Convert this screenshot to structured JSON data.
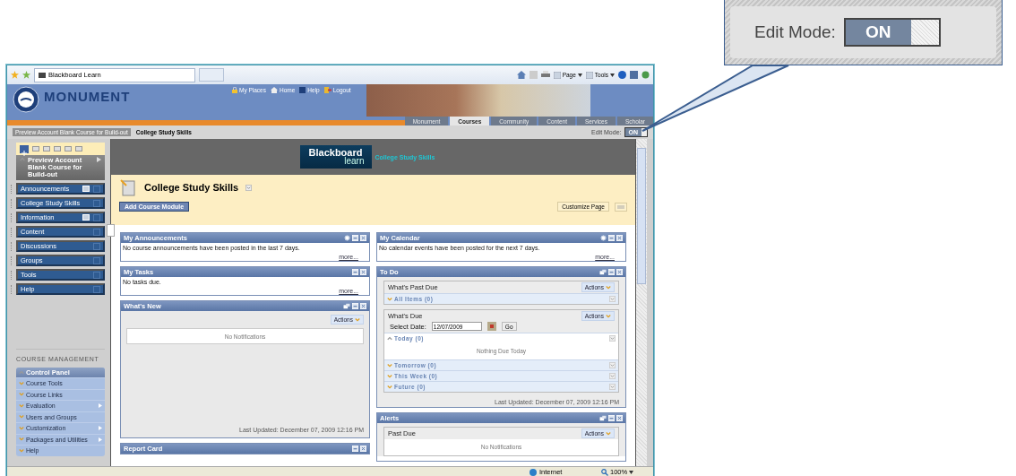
{
  "browser": {
    "tab_title": "Blackboard Learn",
    "menus": [
      "Page",
      "Tools"
    ]
  },
  "header": {
    "brand": "MONUMENT",
    "links": [
      "My Places",
      "Home",
      "Help",
      "Logout"
    ],
    "tabs": [
      {
        "label": "Monument",
        "selected": false
      },
      {
        "label": "Courses",
        "selected": true
      },
      {
        "label": "Community",
        "selected": false
      },
      {
        "label": "Content",
        "selected": false
      },
      {
        "label": "Services",
        "selected": false
      },
      {
        "label": "Scholar",
        "selected": false
      }
    ]
  },
  "breadcrumb": {
    "items": [
      "Preview Account Blank Course for Build-out",
      "College Study Skills"
    ],
    "edit_mode": {
      "label": "Edit Mode:",
      "value": "ON",
      "on": true
    }
  },
  "sidebar": {
    "course_title": "Preview Account Blank Course for Build-out",
    "items": [
      {
        "label": "Announcements",
        "badge": true
      },
      {
        "label": "College Study Skills",
        "badge": false
      },
      {
        "label": "Information",
        "badge": true
      },
      {
        "label": "Content",
        "badge": false
      },
      {
        "label": "Discussions",
        "badge": false
      },
      {
        "label": "Groups",
        "badge": false
      },
      {
        "label": "Tools",
        "badge": false
      },
      {
        "label": "Help",
        "badge": false
      }
    ],
    "management_title": "COURSE MANAGEMENT",
    "control_panel": {
      "title": "Control Panel",
      "expanded": true,
      "items": [
        {
          "label": "Course Tools",
          "submenu": false
        },
        {
          "label": "Course Links",
          "submenu": false
        },
        {
          "label": "Evaluation",
          "submenu": true
        },
        {
          "label": "Users and Groups",
          "submenu": false
        },
        {
          "label": "Customization",
          "submenu": true
        },
        {
          "label": "Packages and Utilities",
          "submenu": true
        },
        {
          "label": "Help",
          "submenu": false
        }
      ]
    }
  },
  "banner": {
    "logo_top": "Blackboard",
    "logo_bottom": "learn",
    "course": "College Study Skills"
  },
  "page": {
    "title": "College Study Skills",
    "add_button": "Add Course Module",
    "customize_button": "Customize Page"
  },
  "modules_left": [
    {
      "kind": "text",
      "title": "My Announcements",
      "settings_icon": true,
      "popout_icon": false,
      "body": "No course announcements have been posted in the last 7 days.",
      "link": "more..."
    },
    {
      "kind": "text",
      "title": "My Tasks",
      "settings_icon": false,
      "popout_icon": false,
      "body": "No tasks due.",
      "link": "more..."
    },
    {
      "kind": "notifications",
      "title": "What's New",
      "settings_icon": false,
      "popout_icon": true,
      "actions": "Actions",
      "empty": "No Notifications",
      "last_updated": "Last Updated: December 07, 2009 12:16 PM"
    },
    {
      "kind": "text",
      "title": "Report Card",
      "settings_icon": false,
      "popout_icon": false
    }
  ],
  "modules_right": [
    {
      "kind": "text",
      "title": "My Calendar",
      "settings_icon": true,
      "popout_icon": false,
      "body": "No calendar events have been posted for the next 7 days.",
      "link": "more..."
    },
    {
      "kind": "groups",
      "title": "To Do",
      "settings_icon": false,
      "popout_icon": true,
      "groups": [
        {
          "title": "What's Past Due",
          "actions": "Actions",
          "rows": [
            {
              "label": "All Items (0)",
              "expanded": false
            }
          ]
        },
        {
          "title": "What's Due",
          "actions": "Actions",
          "date_label": "Select Date:",
          "date_value": "12/07/2009",
          "go": "Go",
          "rows": [
            {
              "label": "Today (0)",
              "expanded": true,
              "empty": "Nothing Due Today"
            },
            {
              "label": "Tomorrow (0)",
              "expanded": false
            },
            {
              "label": "This Week (0)",
              "expanded": false
            },
            {
              "label": "Future (0)",
              "expanded": false
            }
          ]
        }
      ],
      "last_updated": "Last Updated: December 07, 2009 12:16 PM"
    },
    {
      "kind": "groups",
      "title": "Alerts",
      "settings_icon": false,
      "popout_icon": true,
      "groups": [
        {
          "title": "Past Due",
          "actions": "Actions",
          "empty": "No Notifications"
        }
      ]
    }
  ],
  "status_bar": {
    "zone": "Internet",
    "zoom": "100%"
  },
  "callout": {
    "label": "Edit Mode:",
    "value": "ON",
    "on": true
  }
}
